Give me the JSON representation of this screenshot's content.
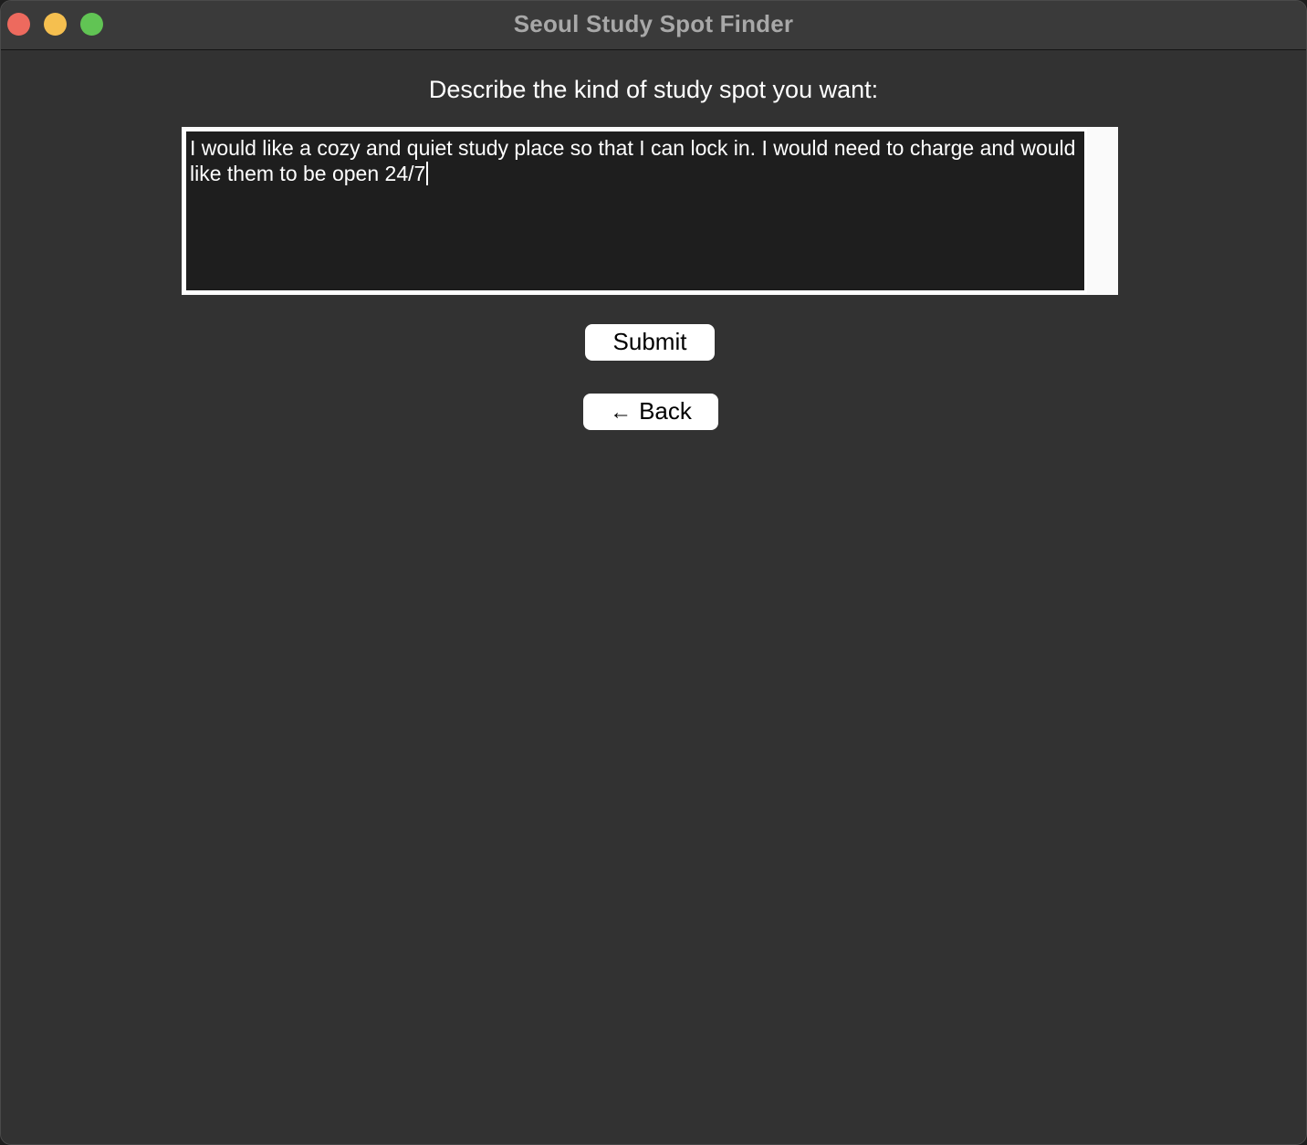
{
  "window": {
    "title": "Seoul Study Spot Finder",
    "controls": {
      "close_color": "#ed6a5e",
      "minimize_color": "#f5bf4f",
      "zoom_color": "#61c454"
    }
  },
  "main": {
    "prompt_label": "Describe the kind of study spot you want:",
    "description_value": "I would like a cozy and quiet study place so that I can lock in. I would need to charge and would like them to be open 24/7",
    "submit_label": "Submit",
    "back_icon": "arrow-left-icon",
    "back_label": "Back"
  }
}
